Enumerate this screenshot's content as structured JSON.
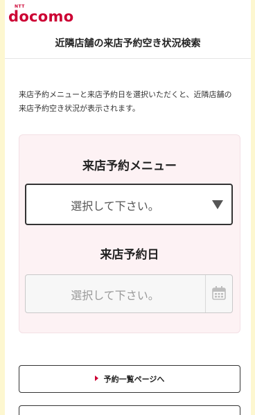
{
  "header": {
    "logo_ntt": "NTT",
    "logo_text": "docomo",
    "page_title": "近隣店舗の来店予約空き状況検索"
  },
  "description": "来店予約メニューと来店予約日を選択いただくと、近隣店舗の来店予約空き状況が表示されます。",
  "form": {
    "menu_label": "来店予約メニュー",
    "menu_value": "選択して下さい。",
    "date_label": "来店予約日",
    "date_placeholder": "選択して下さい。"
  },
  "buttons": {
    "reservation_list": "予約一覧ページへ"
  },
  "colors": {
    "brand": "#cc0033",
    "panel_bg": "#fdf2f4",
    "page_bg": "#fdf7d0"
  }
}
